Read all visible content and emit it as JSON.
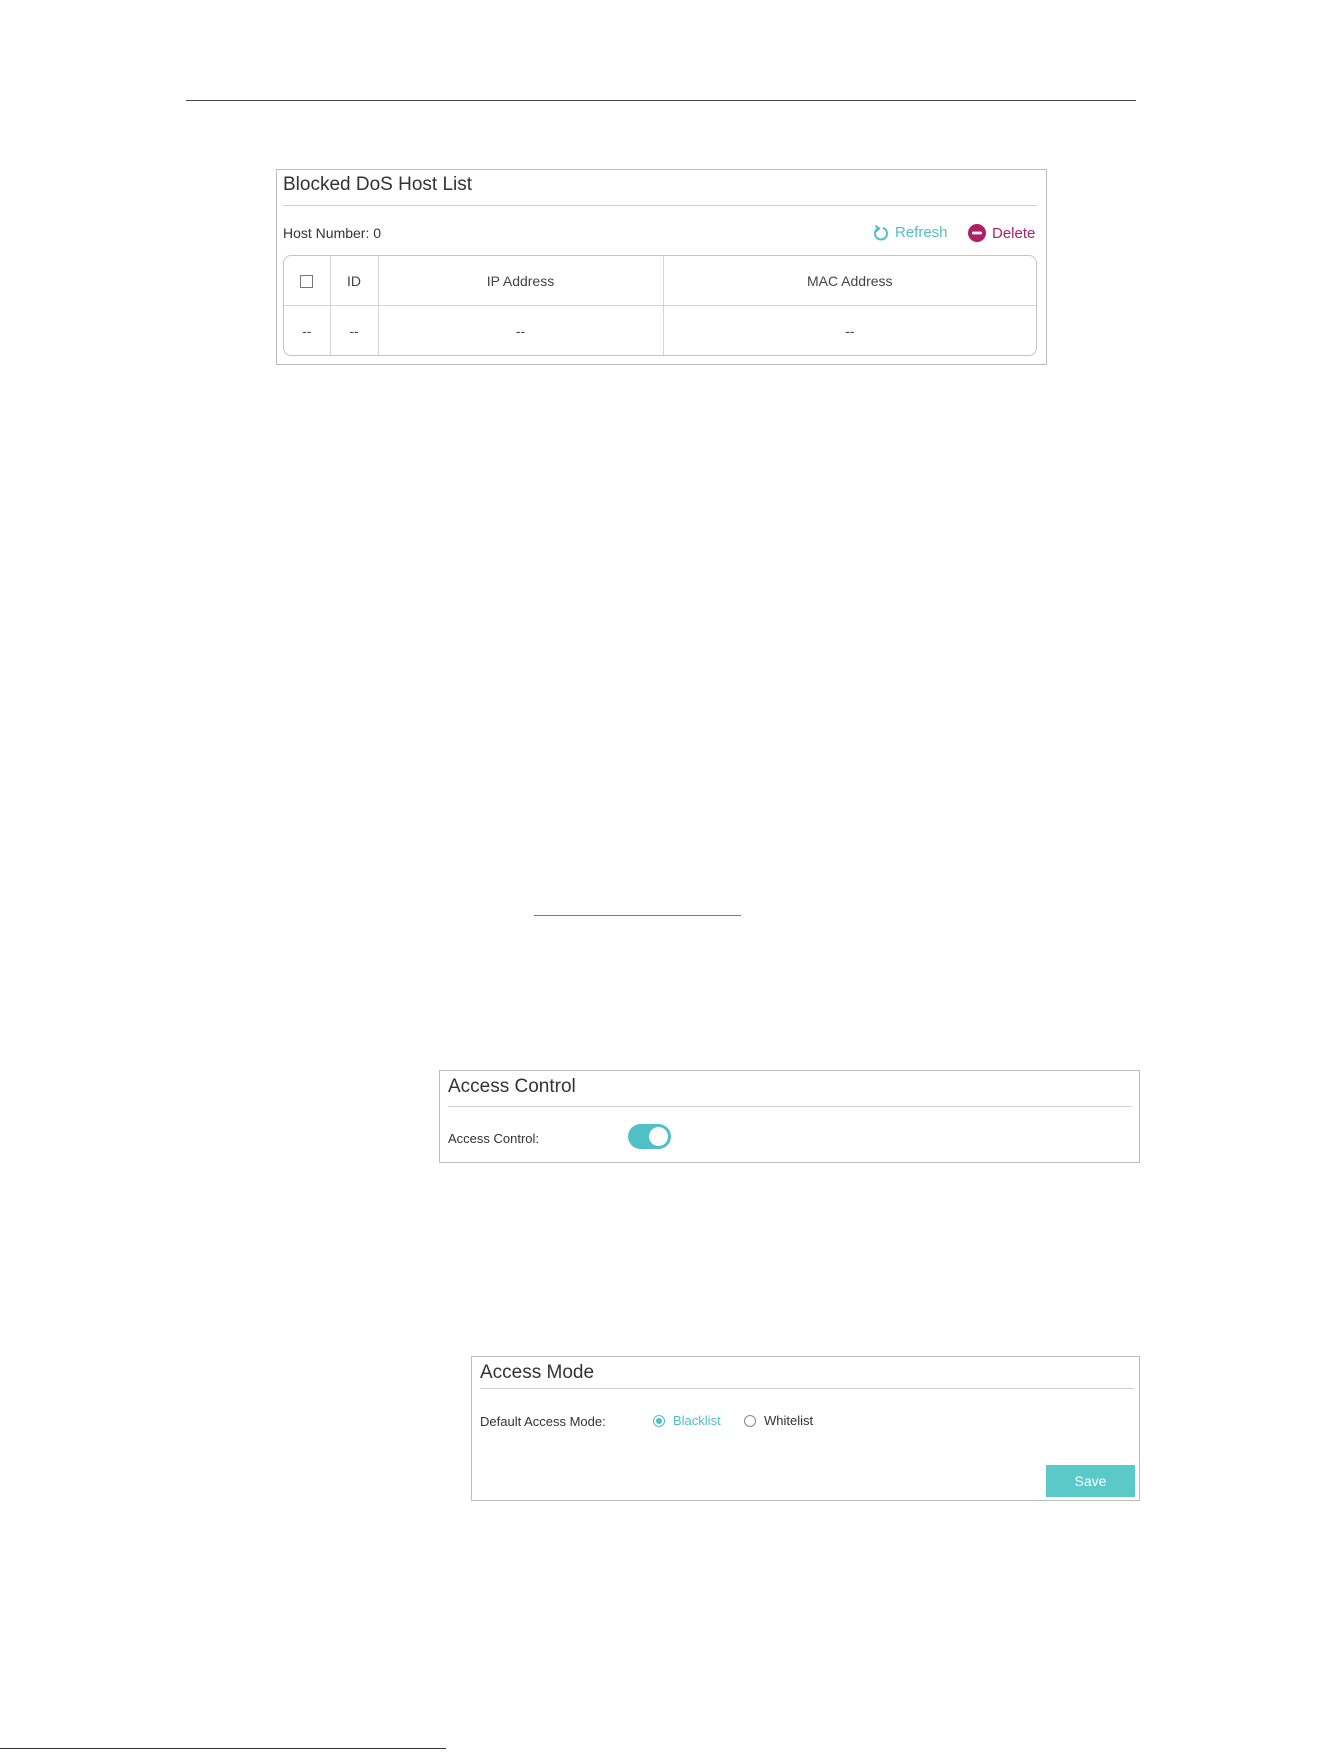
{
  "blocked_dos": {
    "title": "Blocked DoS Host List",
    "host_number_label": "Host Number: 0",
    "refresh_label": "Refresh",
    "delete_label": "Delete",
    "columns": [
      "",
      "ID",
      "IP Address",
      "MAC Address"
    ],
    "rows": [
      [
        "--",
        "--",
        "--",
        "--"
      ]
    ]
  },
  "access_control": {
    "title": "Access Control",
    "label": "Access Control:",
    "enabled": true
  },
  "access_mode": {
    "title": "Access Mode",
    "label": "Default Access Mode:",
    "options": [
      "Blacklist",
      "Whitelist"
    ],
    "selected": "Blacklist",
    "save_label": "Save"
  },
  "colors": {
    "accent": "#4fc0c5",
    "delete": "#b11e66"
  }
}
